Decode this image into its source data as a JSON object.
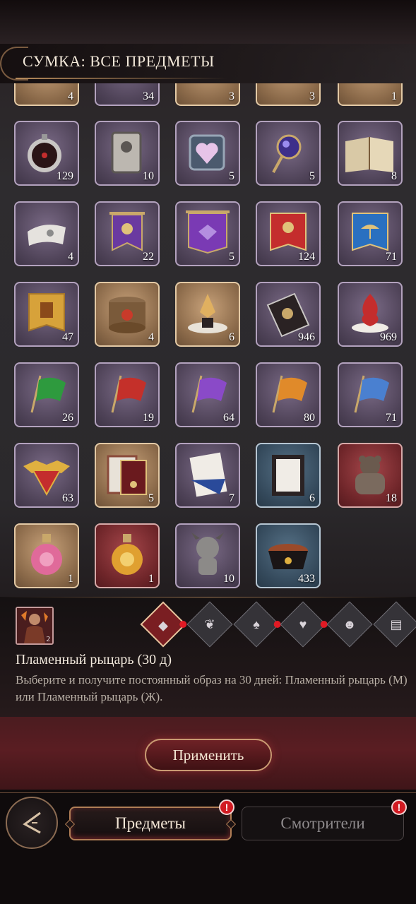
{
  "header": {
    "title": "СУМКА: ВСЕ ПРЕДМЕТЫ"
  },
  "grid": {
    "partial_row": [
      {
        "count": "4",
        "rarity": "gold"
      },
      {
        "count": "34",
        "rarity": "purple"
      },
      {
        "count": "3",
        "rarity": "gold"
      },
      {
        "count": "3",
        "rarity": "gold"
      },
      {
        "count": "1",
        "rarity": "gold"
      }
    ],
    "rows": [
      [
        {
          "name": "pocket-watch-icon",
          "count": "129",
          "rarity": "purple"
        },
        {
          "name": "card-icon",
          "count": "10",
          "rarity": "purple"
        },
        {
          "name": "heart-frame-icon",
          "count": "5",
          "rarity": "purple"
        },
        {
          "name": "magic-mirror-icon",
          "count": "5",
          "rarity": "purple"
        },
        {
          "name": "open-book-icon",
          "count": "8",
          "rarity": "purple"
        }
      ],
      [
        {
          "name": "scroll-icon",
          "count": "4",
          "rarity": "purple"
        },
        {
          "name": "purple-banner-icon",
          "count": "22",
          "rarity": "purple"
        },
        {
          "name": "purple-wide-banner-icon",
          "count": "5",
          "rarity": "purple"
        },
        {
          "name": "red-banner-icon",
          "count": "124",
          "rarity": "purple"
        },
        {
          "name": "blue-banner-icon",
          "count": "71",
          "rarity": "purple"
        }
      ],
      [
        {
          "name": "gold-banner-icon",
          "count": "47",
          "rarity": "purple"
        },
        {
          "name": "hat-box-icon",
          "count": "4",
          "rarity": "gold"
        },
        {
          "name": "pedestal-crest-icon",
          "count": "6",
          "rarity": "gold"
        },
        {
          "name": "envelope-icon",
          "count": "946",
          "rarity": "purple"
        },
        {
          "name": "red-swirl-icon",
          "count": "969",
          "rarity": "purple"
        }
      ],
      [
        {
          "name": "green-flag-icon",
          "count": "26",
          "rarity": "purple"
        },
        {
          "name": "red-flag-icon",
          "count": "19",
          "rarity": "purple"
        },
        {
          "name": "purple-flag-icon",
          "count": "64",
          "rarity": "purple"
        },
        {
          "name": "orange-flag-icon",
          "count": "80",
          "rarity": "purple"
        },
        {
          "name": "blue-flag-icon",
          "count": "71",
          "rarity": "purple"
        }
      ],
      [
        {
          "name": "bat-emblem-icon",
          "count": "63",
          "rarity": "purple"
        },
        {
          "name": "certificate-icon",
          "count": "5",
          "rarity": "gold"
        },
        {
          "name": "document-icon",
          "count": "7",
          "rarity": "purple"
        },
        {
          "name": "framed-document-icon",
          "count": "6",
          "rarity": "blue"
        },
        {
          "name": "bear-figure-icon",
          "count": "18",
          "rarity": "red"
        }
      ],
      [
        {
          "name": "pink-potion-icon",
          "count": "1",
          "rarity": "gold"
        },
        {
          "name": "gold-potion-icon",
          "count": "1",
          "rarity": "red"
        },
        {
          "name": "plush-doll-icon",
          "count": "10",
          "rarity": "purple"
        },
        {
          "name": "pet-food-bowl-icon",
          "count": "433",
          "rarity": "blue"
        }
      ]
    ]
  },
  "detail": {
    "thumb_count": "2",
    "name": "Пламенный рыцарь (30 д)",
    "description": "Выберите и получите постоянный образ на 30 дней: Пламенный рыцарь (М) или Пламенный рыцарь (Ж).",
    "categories": [
      {
        "icon": "diamond-grid-icon",
        "active": true,
        "alert": true
      },
      {
        "icon": "drops-icon",
        "active": false,
        "alert": false
      },
      {
        "icon": "character-icon",
        "active": false,
        "alert": true
      },
      {
        "icon": "hearts-icon",
        "active": false,
        "alert": true
      },
      {
        "icon": "cat-icon",
        "active": false,
        "alert": false
      },
      {
        "icon": "tickets-icon",
        "active": false,
        "alert": false
      }
    ]
  },
  "apply_button": "Применить",
  "tabs": {
    "items": "Предметы",
    "keepers": "Смотрители"
  },
  "alert_glyph": "!"
}
